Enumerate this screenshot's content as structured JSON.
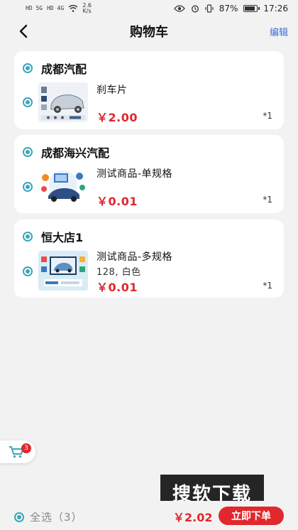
{
  "status_bar": {
    "network_left": "HD 5G",
    "network_right": "HD 4G",
    "speed_value": "2.6",
    "speed_unit": "K/s",
    "battery": "87%",
    "time": "17:26"
  },
  "nav": {
    "title": "购物车",
    "edit_label": "编辑"
  },
  "shops": [
    {
      "name": "成都汽配",
      "items": [
        {
          "name": "刹车片",
          "spec": "",
          "price": "￥2.00",
          "qty": "*1",
          "thumb_icon": "car-parts-thumbnail"
        }
      ]
    },
    {
      "name": "成都海兴汽配",
      "items": [
        {
          "name": "测试商品-单规格",
          "spec": "",
          "price": "￥0.01",
          "qty": "*1",
          "thumb_icon": "car-service-thumbnail"
        }
      ]
    },
    {
      "name": "恒大店1",
      "items": [
        {
          "name": "测试商品-多规格",
          "spec": "128, 白色",
          "price": "￥0.01",
          "qty": "*1",
          "thumb_icon": "car-diagnostics-thumbnail"
        }
      ]
    }
  ],
  "float_cart": {
    "badge": "3",
    "icon": "cart-icon"
  },
  "bottom": {
    "select_all_label": "全选（3）",
    "total": "￥2.02",
    "checkout_label": "立即下单"
  },
  "watermark": "搜软下载",
  "colors": {
    "accent": "#3aa6b9",
    "price": "#e0282e",
    "link": "#3b6fd4",
    "background": "#f2f2f2"
  }
}
